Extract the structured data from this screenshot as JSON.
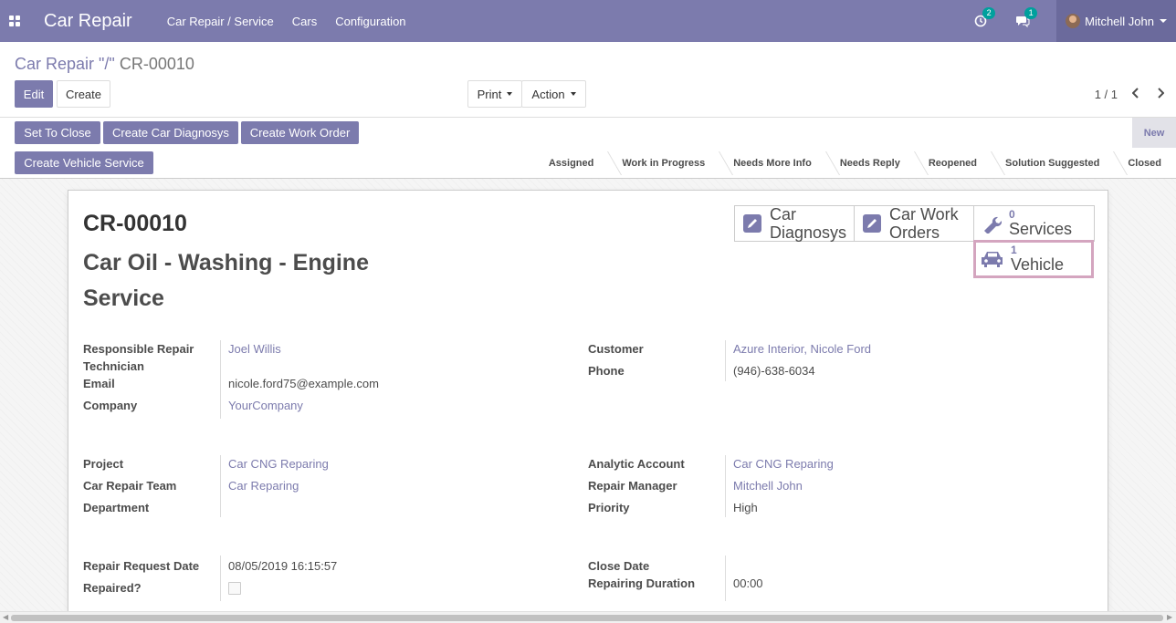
{
  "navbar": {
    "app_title": "Car Repair",
    "menus": [
      "Car Repair / Service",
      "Cars",
      "Configuration"
    ],
    "activity_count": "2",
    "message_count": "1",
    "user_name": "Mitchell John"
  },
  "breadcrumb": {
    "parent": "Car Repair \"/\"",
    "current": "CR-00010"
  },
  "toolbar": {
    "edit_label": "Edit",
    "create_label": "Create",
    "print_label": "Print",
    "action_label": "Action",
    "pager": "1 / 1"
  },
  "statusbar": {
    "buttons": [
      "Set To Close",
      "Create Car Diagnosys",
      "Create Work Order",
      "Create Vehicle Service"
    ],
    "new_label": "New",
    "stages": [
      "Assigned",
      "Work in Progress",
      "Needs More Info",
      "Needs Reply",
      "Reopened",
      "Solution Suggested",
      "Closed"
    ]
  },
  "record": {
    "name": "CR-00010",
    "title": "Car Oil - Washing - Engine Service"
  },
  "smart_buttons": {
    "diagnosys_line1": "Car",
    "diagnosys_line2": "Diagnosys",
    "work_orders_line1": "Car Work",
    "work_orders_line2": "Orders",
    "services_count": "0",
    "services_label": "Services",
    "vehicle_count": "1",
    "vehicle_label": "Vehicle"
  },
  "fields": {
    "technician_label_1": "Responsible Repair",
    "technician_label_2": "Technician",
    "technician": "Joel Willis",
    "email_label": "Email",
    "email": "nicole.ford75@example.com",
    "company_label": "Company",
    "company": "YourCompany",
    "customer_label": "Customer",
    "customer": "Azure Interior, Nicole Ford",
    "phone_label": "Phone",
    "phone": "(946)-638-6034",
    "project_label": "Project",
    "project": "Car CNG Reparing",
    "team_label": "Car Repair Team",
    "team": "Car Reparing",
    "department_label": "Department",
    "analytic_label": "Analytic Account",
    "analytic": "Car CNG Reparing",
    "manager_label": "Repair Manager",
    "manager": "Mitchell John",
    "priority_label": "Priority",
    "priority": "High",
    "request_date_label": "Repair Request Date",
    "request_date": "08/05/2019 16:15:57",
    "repaired_label": "Repaired?",
    "close_date_label": "Close Date",
    "duration_label": "Repairing Duration",
    "duration": "00:00"
  },
  "colors": {
    "brand": "#7c7bad",
    "badge": "#00a09d",
    "highlight_border": "#d4a5bf"
  }
}
